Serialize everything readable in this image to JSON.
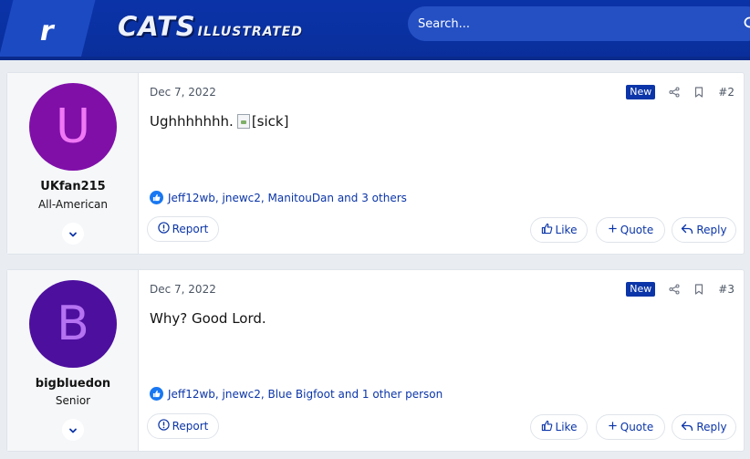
{
  "header": {
    "rivals_logo": "r",
    "site_title_big": "CATS",
    "site_title_small": "ILLUSTRATED",
    "search_placeholder": "Search..."
  },
  "posts": [
    {
      "username": "UKfan215",
      "user_title": "All-American",
      "avatar_letter": "U",
      "avatar_bg": "#800fa8",
      "avatar_fg": "#f078f5",
      "date": "Dec 7, 2022",
      "badge": "New",
      "number": "#2",
      "body_text": "Ughhhhhhh.",
      "body_image_alt": "[sick]",
      "reactions": "Jeff12wb, jnewc2, ManitouDan and 3 others",
      "report_label": "Report",
      "like_label": "Like",
      "quote_label": "Quote",
      "reply_label": "Reply"
    },
    {
      "username": "bigbluedon",
      "user_title": "Senior",
      "avatar_letter": "B",
      "avatar_bg": "#4d0f9e",
      "avatar_fg": "#b573f2",
      "date": "Dec 7, 2022",
      "badge": "New",
      "number": "#3",
      "body_text": "Why? Good Lord.",
      "body_image_alt": "",
      "reactions": "Jeff12wb, jnewc2, Blue Bigfoot and 1 other person",
      "report_label": "Report",
      "like_label": "Like",
      "quote_label": "Quote",
      "reply_label": "Reply"
    }
  ],
  "colors": {
    "brand_blue": "#0b35a8",
    "link_blue": "#0b35a8",
    "like_blue": "#1877f2"
  },
  "icons": {
    "search": "search-icon",
    "share": "share-icon",
    "bookmark": "bookmark-icon",
    "expand": "chevron-down-icon",
    "like_reaction": "thumbs-up-icon",
    "report": "info-circle-icon",
    "quote": "plus-icon",
    "reply": "reply-arrow-icon"
  }
}
